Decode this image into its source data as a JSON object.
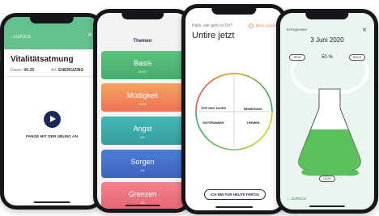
{
  "screen1": {
    "back_label": "‹ ZURÜCK",
    "close_glyph": "×",
    "title": "Vitalitätsatmung",
    "duration_label": "Dauer:",
    "duration_value": "06:25",
    "type_label": "Art:",
    "type_value": "ENERGIZING",
    "play_label": "FANGE MIT DER ÜBUNG AN",
    "header_color": "#64c08c"
  },
  "screen2": {
    "heading": "Themen",
    "topics": [
      {
        "name": "Basis",
        "count": "20/20"
      },
      {
        "name": "Müdigkeit",
        "count": "10/10"
      },
      {
        "name": "Angst",
        "count": "5/5"
      },
      {
        "name": "Sorgen",
        "count": "4/4"
      },
      {
        "name": "Grenzen",
        "count": "3/3"
      }
    ]
  },
  "screen3": {
    "greeting": "Hallo, wie geht es Dir?",
    "my_untire": "Mein Untire",
    "title": "Untire jetzt",
    "quadrants": [
      "TIPP DES TAGES",
      "BEWEGUNG",
      "ENTSPANNEN",
      "THEMEN"
    ],
    "done_button": "ICH BIN FÜR HEUTE FERTIG"
  },
  "screen4": {
    "label": "Energievase",
    "close_glyph": "×",
    "date": "3 Juni 2020",
    "rein_label": "REIN",
    "raus_label": "RAUS",
    "level_label": "50 %",
    "level_fraction": 0.5,
    "leck_label": "LECK",
    "back_label": "← ZURÜCK",
    "fill_color": "#5cc15a"
  }
}
